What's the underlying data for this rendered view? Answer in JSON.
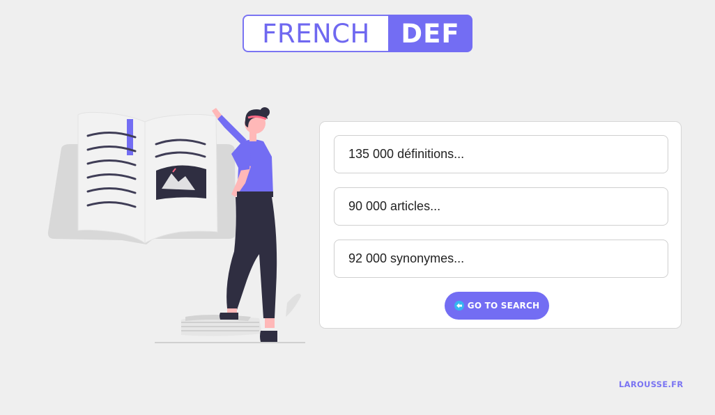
{
  "logo": {
    "left_text": "FRENCH",
    "right_text": "DEF"
  },
  "stats": [
    {
      "text": "135 000 définitions..."
    },
    {
      "text": "90 000 articles..."
    },
    {
      "text": "92 000 synonymes..."
    }
  ],
  "search_button": {
    "label": "GO TO SEARCH",
    "icon": "arrow-left-circle-icon"
  },
  "footer": {
    "link_label": "LAROUSSE.FR"
  },
  "colors": {
    "accent": "#736df3",
    "background": "#efefef",
    "card": "#ffffff",
    "figure_dark": "#2f2e41",
    "skin": "#ffb8b8",
    "book_gray": "#d8d8d8"
  }
}
